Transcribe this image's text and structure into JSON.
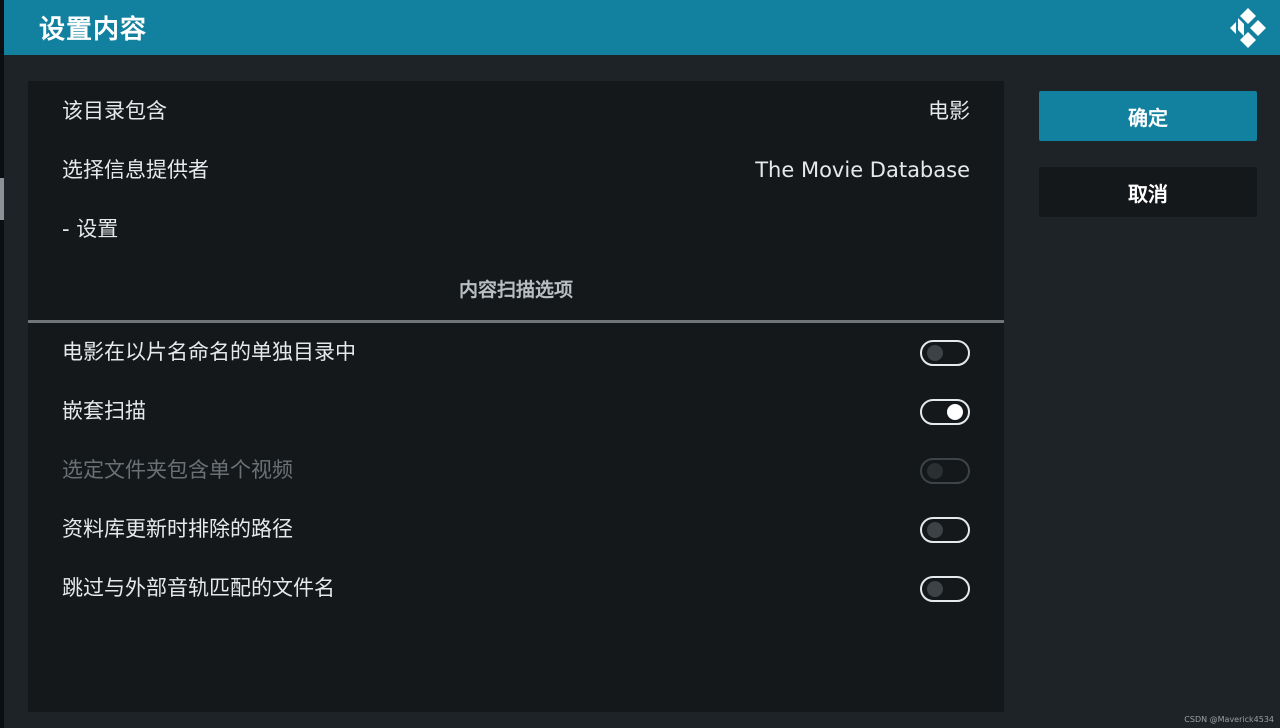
{
  "header": {
    "title": "设置内容"
  },
  "settings": {
    "directory_contains": {
      "label": "该目录包含",
      "value": "电影"
    },
    "info_provider": {
      "label": "选择信息提供者",
      "value": "The Movie Database"
    },
    "settings_link": {
      "label": "- 设置"
    }
  },
  "scan_options": {
    "title": "内容扫描选项",
    "items": [
      {
        "label": "电影在以片名命名的单独目录中",
        "state": "off",
        "enabled": true
      },
      {
        "label": "嵌套扫描",
        "state": "on",
        "enabled": true
      },
      {
        "label": "选定文件夹包含单个视频",
        "state": "off",
        "enabled": false
      },
      {
        "label": "资料库更新时排除的路径",
        "state": "off",
        "enabled": true
      },
      {
        "label": "跳过与外部音轨匹配的文件名",
        "state": "off",
        "enabled": true
      }
    ]
  },
  "buttons": {
    "ok": "确定",
    "cancel": "取消"
  },
  "watermark": "CSDN @Maverick4534",
  "colors": {
    "accent": "#12819f",
    "background": "#1d2327",
    "panel": "#14181a"
  }
}
